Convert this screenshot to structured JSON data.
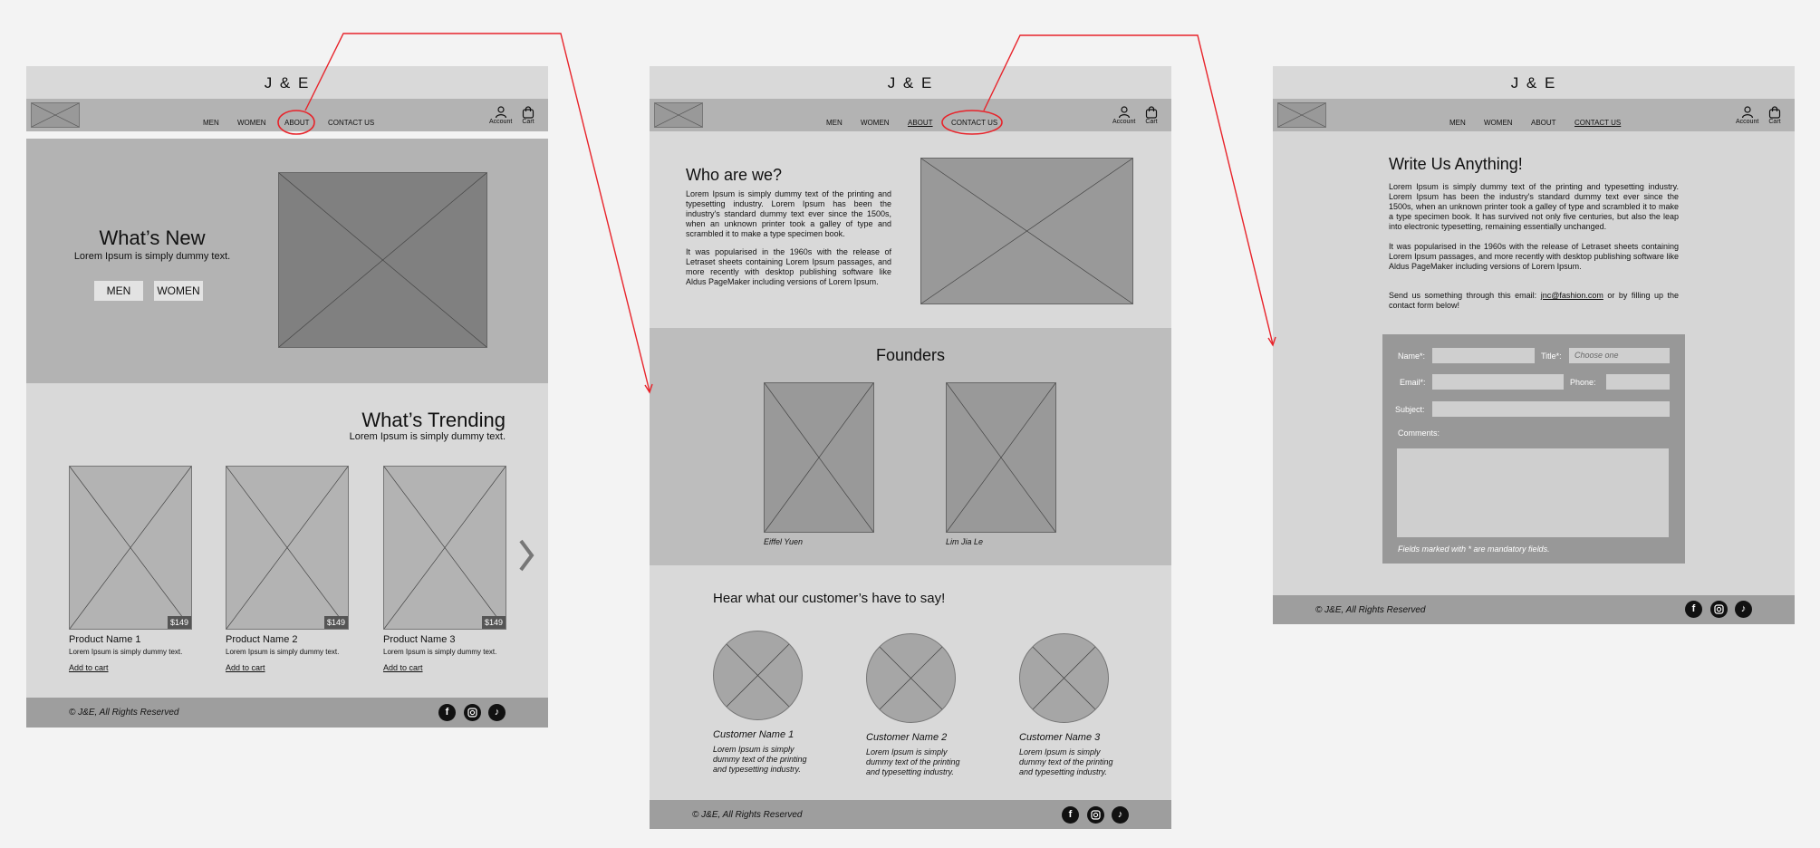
{
  "brand": "J & E",
  "nav": {
    "men": "MEN",
    "women": "WOMEN",
    "about": "ABOUT",
    "contact": "CONTACT US",
    "account": "Account",
    "cart": "Cart"
  },
  "home": {
    "hero_title": "What’s New",
    "hero_subtitle": "Lorem Ipsum is simply dummy text.",
    "btn_men": "MEN",
    "btn_women": "WOMEN",
    "trending_title": "What’s Trending",
    "trending_subtitle": "Lorem Ipsum is simply dummy text.",
    "products": [
      {
        "name": "Product Name 1",
        "desc": "Lorem Ipsum is simply dummy text.",
        "price": "$149",
        "cta": "Add to cart"
      },
      {
        "name": "Product Name 2",
        "desc": "Lorem Ipsum is simply dummy text.",
        "price": "$149",
        "cta": "Add to cart"
      },
      {
        "name": "Product Name 3",
        "desc": "Lorem Ipsum is simply dummy text.",
        "price": "$149",
        "cta": "Add to cart"
      }
    ]
  },
  "about": {
    "who_title": "Who are we?",
    "who_p1": "Lorem Ipsum is simply dummy text of the printing and typesetting industry. Lorem Ipsum has been the industry's standard dummy text ever since the 1500s, when an unknown printer took a galley of type and scrambled it to make a type specimen book.",
    "who_p2": "It was popularised in the 1960s with the release of Letraset sheets containing Lorem Ipsum passages, and more recently with desktop publishing software like Aldus PageMaker including versions of Lorem Ipsum.",
    "founders_title": "Founders",
    "founders": [
      "Eiffel Yuen",
      "Lim Jia Le"
    ],
    "reviews_title": "Hear what our customer’s have to say!",
    "customers": [
      {
        "name": "Customer Name 1",
        "text": "Lorem Ipsum is simply dummy text of the printing and typesetting industry."
      },
      {
        "name": "Customer Name 2",
        "text": "Lorem Ipsum is simply dummy text of the printing and typesetting industry."
      },
      {
        "name": "Customer Name 3",
        "text": "Lorem Ipsum is simply dummy text of the printing and typesetting industry."
      }
    ]
  },
  "contact": {
    "title": "Write Us Anything!",
    "p1": "Lorem Ipsum is simply dummy text of the printing and typesetting industry. Lorem Ipsum has been the industry's standard dummy text ever since the 1500s, when an unknown printer took a galley of type and scrambled it to make a type specimen book. It has survived not only five centuries, but also the leap into electronic typesetting, remaining essentially unchanged.",
    "p2": "It was popularised in the 1960s with the release of Letraset sheets containing Lorem Ipsum passages, and more recently with desktop publishing software like Aldus PageMaker including versions of Lorem Ipsum.",
    "p3_before": "Send us something through this email: ",
    "email": "jnc@fashion.com",
    "p3_after": " or by filling up the contact form below!",
    "form": {
      "name_label": "Name*:",
      "title_label": "Title*:",
      "title_placeholder": "Choose one",
      "email_label": "Email*:",
      "phone_label": "Phone:",
      "subject_label": "Subject:",
      "comments_label": "Comments:",
      "note": "Fields marked with * are mandatory fields."
    }
  },
  "footer": {
    "copyright": "© J&E, All Rights Reserved",
    "facebook": "f",
    "tiktok": "♪"
  },
  "colors": {
    "annotation": "#e8232a",
    "header_bg": "#d9d9d9",
    "nav_bg": "#b3b3b3",
    "footer_bg": "#9e9e9e"
  },
  "icons": [
    "logo-placeholder",
    "account-icon",
    "cart-icon",
    "chevron-right-icon",
    "facebook-icon",
    "instagram-icon",
    "tiktok-icon"
  ]
}
